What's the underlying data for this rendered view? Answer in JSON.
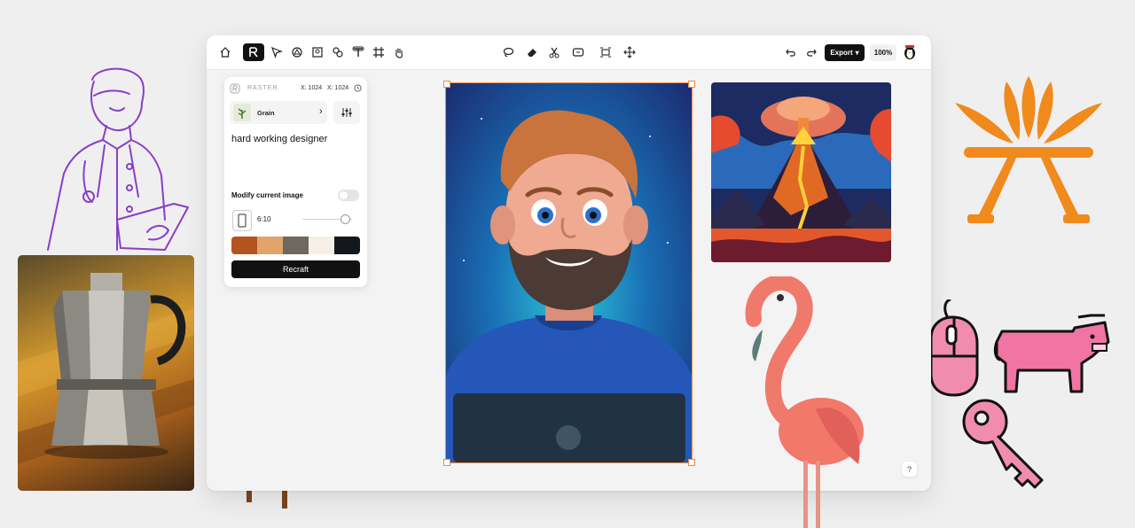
{
  "toolbar": {
    "export_label": "Export",
    "zoom": "100%"
  },
  "panel": {
    "mode_label": "RASTER",
    "width_label": "X: 1024",
    "height_label": "X: 1024",
    "style_name": "Grain",
    "prompt": "hard working designer",
    "modify_label": "Modify current image",
    "aspect_ratio": "6:10",
    "palette": [
      "#b5531f",
      "#e3a46b",
      "#6f6760",
      "#f6efe6",
      "#14181d"
    ],
    "recraft_label": "Recraft"
  },
  "help": "?",
  "colors": {
    "accent_orange": "#f08a1c",
    "selection": "#ef8a3a",
    "line_art_purple": "#8b3ec7"
  }
}
